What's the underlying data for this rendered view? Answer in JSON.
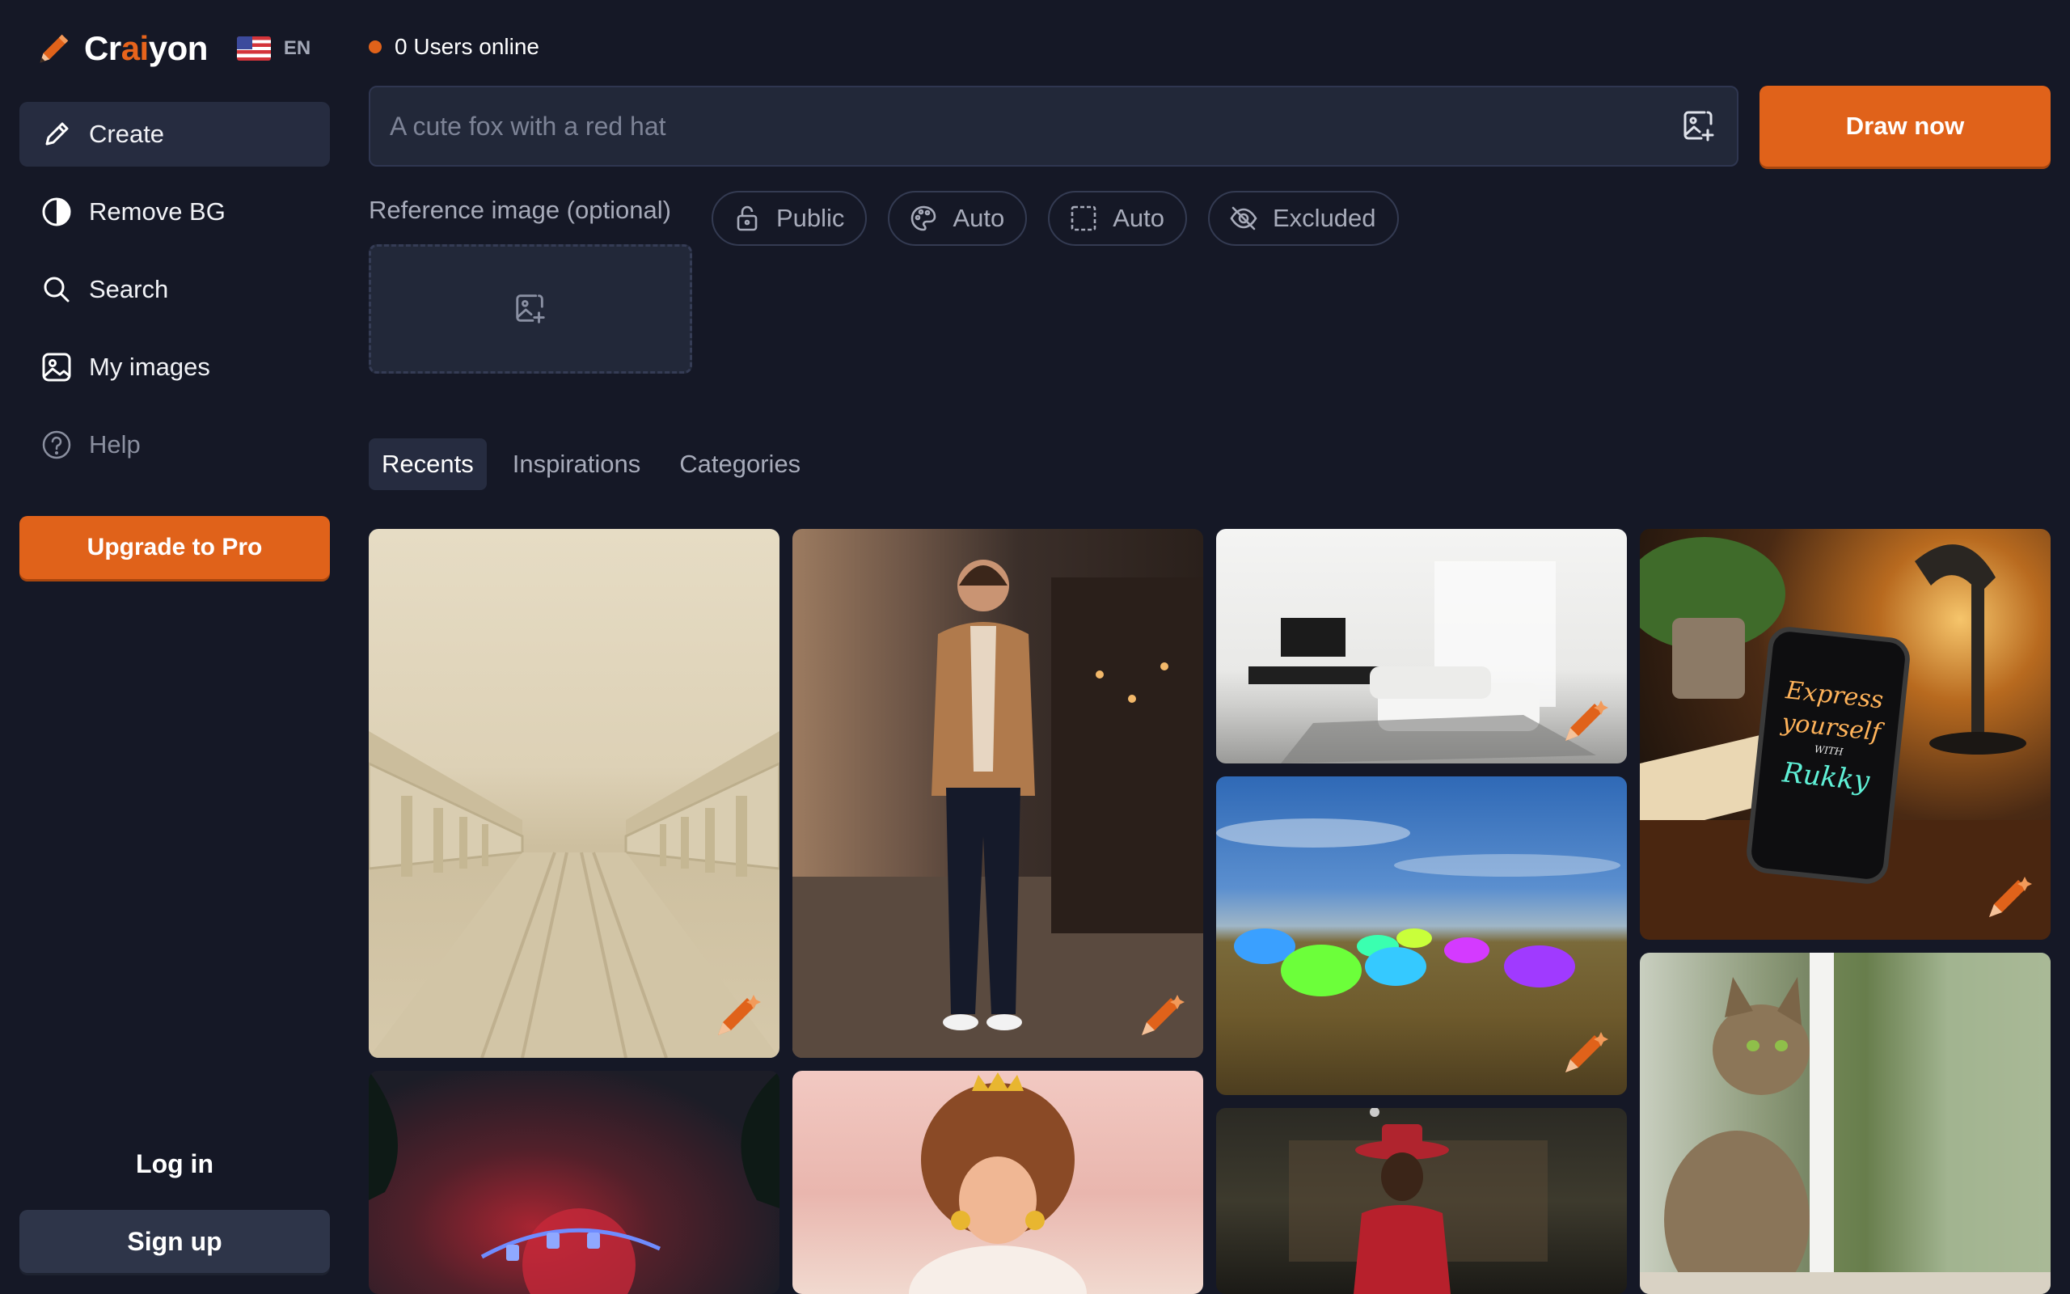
{
  "brand": {
    "prefix": "Cr",
    "accent": "ai",
    "suffix": "yon",
    "language": "EN",
    "accent_color": "#e0621a"
  },
  "nav": {
    "items": [
      {
        "label": "Create",
        "icon": "pencil-icon",
        "active": true
      },
      {
        "label": "Remove BG",
        "icon": "half-circle-icon"
      },
      {
        "label": "Search",
        "icon": "search-icon"
      },
      {
        "label": "My images",
        "icon": "image-icon"
      },
      {
        "label": "Help",
        "icon": "help-icon"
      }
    ],
    "upgrade_label": "Upgrade to Pro",
    "login_label": "Log in",
    "signup_label": "Sign up"
  },
  "status": {
    "users_online": "0 Users online"
  },
  "prompt": {
    "placeholder": "A cute fox with a red hat",
    "value": "",
    "draw_label": "Draw now"
  },
  "reference": {
    "label": "Reference image (optional)"
  },
  "options": [
    {
      "label": "Public",
      "icon": "lock-icon"
    },
    {
      "label": "Auto",
      "icon": "palette-icon"
    },
    {
      "label": "Auto",
      "icon": "aspect-ratio-icon"
    },
    {
      "label": "Excluded",
      "icon": "eye-off-icon"
    }
  ],
  "tabs": [
    {
      "label": "Recents",
      "active": true
    },
    {
      "label": "Inspirations"
    },
    {
      "label": "Categories"
    }
  ],
  "gallery": {
    "tiles": [
      {
        "alt": "Empty train platform with arches"
      },
      {
        "alt": "Smiling man in tan blazer on street"
      },
      {
        "alt": "White minimalist living room"
      },
      {
        "alt": "Phone on desk showing neon text",
        "phone_text": [
          "Express",
          "yourself",
          "WITH",
          "Rukky"
        ]
      },
      {
        "alt": "Neon cows grazing in a field"
      },
      {
        "alt": "Tabby cat by a window"
      },
      {
        "alt": "Dark fantasy scene with red moon"
      },
      {
        "alt": "Cartoon girl with crown and afro"
      },
      {
        "alt": "Man in red suit and cowboy hat"
      }
    ]
  }
}
